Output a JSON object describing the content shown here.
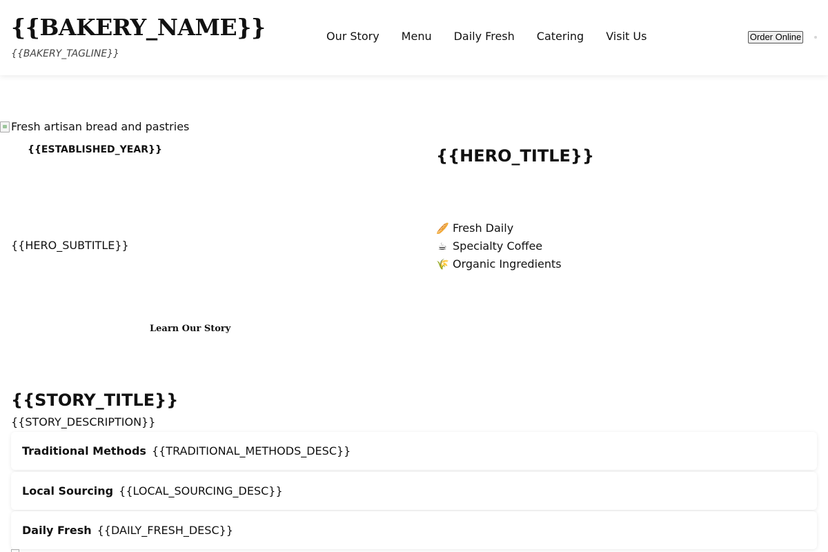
{
  "header": {
    "brand_name": "{{BAKERY_NAME}}",
    "tagline": "{{BAKERY_TAGLINE}}",
    "nav": [
      "Our Story",
      "Menu",
      "Daily Fresh",
      "Catering",
      "Visit Us"
    ],
    "order_label": "Order Online"
  },
  "hero": {
    "image_alt": "Fresh artisan bread and pastries",
    "established_year": "{{ESTABLISHED_YEAR}}",
    "subtitle": "{{HERO_SUBTITLE}}",
    "cta_label": "Learn Our Story",
    "title": "{{HERO_TITLE}}",
    "features": [
      {
        "icon": "🥖",
        "icon_name": "baguette-icon",
        "label": "Fresh Daily"
      },
      {
        "icon": "☕",
        "icon_name": "coffee-icon",
        "label": "Specialty Coffee"
      },
      {
        "icon": "🌾",
        "icon_name": "wheat-icon",
        "label": "Organic Ingredients"
      }
    ]
  },
  "story": {
    "title": "{{STORY_TITLE}}",
    "description": "{{STORY_DESCRIPTION}}",
    "cards": [
      {
        "title": "Traditional Methods",
        "desc": "{{TRADITIONAL_METHODS_DESC}}"
      },
      {
        "title": "Local Sourcing",
        "desc": "{{LOCAL_SOURCING_DESC}}"
      },
      {
        "title": "Daily Fresh",
        "desc": "{{DAILY_FRESH_DESC}}"
      }
    ]
  }
}
